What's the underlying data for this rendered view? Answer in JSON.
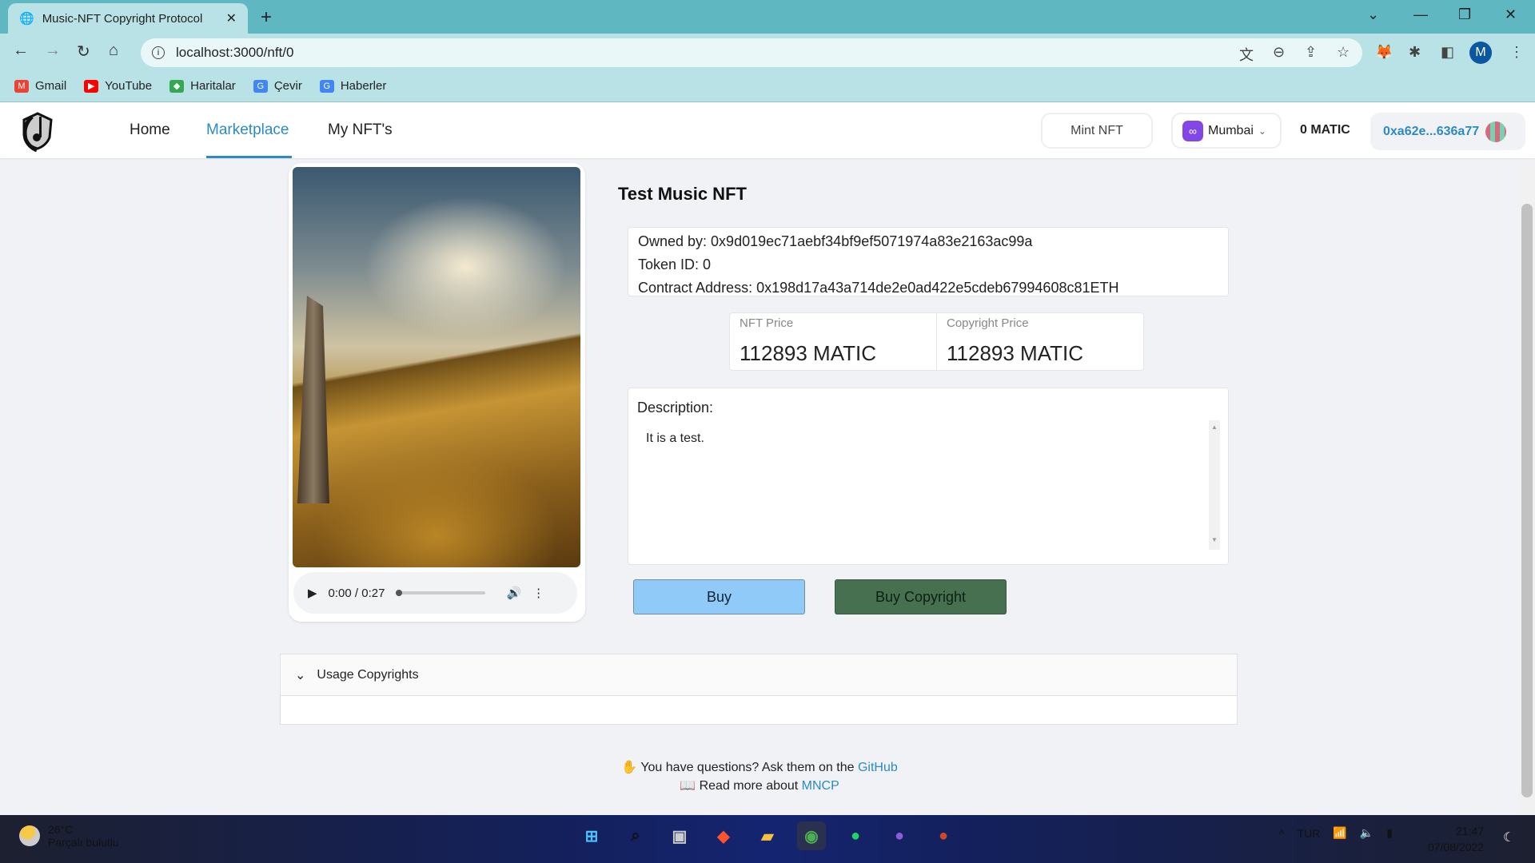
{
  "browser": {
    "tab_title": "Music-NFT Copyright Protocol",
    "url": "localhost:3000/nft/0",
    "bookmarks": [
      {
        "label": "Gmail",
        "color": "#ea4335"
      },
      {
        "label": "YouTube",
        "color": "#ff0000"
      },
      {
        "label": "Haritalar",
        "color": "#34a853"
      },
      {
        "label": "Çevir",
        "color": "#4285f4"
      },
      {
        "label": "Haberler",
        "color": "#4285f4"
      }
    ],
    "profile_initial": "M"
  },
  "app": {
    "nav": {
      "home": "Home",
      "marketplace": "Marketplace",
      "my_nfts": "My NFT's",
      "active": "Marketplace"
    },
    "mint_label": "Mint NFT",
    "network": "Mumbai",
    "balance": "0 MATIC",
    "account": "0xa62e...636a77",
    "accent": "#2b8bc4"
  },
  "nft": {
    "title": "Test Music NFT",
    "owned_by": "Owned by: 0x9d019ec71aebf34bf9ef5071974a83e2163ac99a",
    "token_id": "Token ID: 0",
    "contract": "Contract Address: 0x198d17a43a714de2e0ad422e5cdeb67994608c81ETH",
    "nft_price_label": "NFT Price",
    "nft_price": "112893 MATIC",
    "copyright_price_label": "Copyright Price",
    "copyright_price": "112893 MATIC",
    "description_label": "Description:",
    "description": "It is a test.",
    "audio_time": "0:00 / 0:27",
    "buy_label": "Buy",
    "buy_copyright_label": "Buy Copyright",
    "buy_color": "#90caf9",
    "buy_copyright_color": "#46704f"
  },
  "usage": {
    "label": "Usage Copyrights"
  },
  "footer": {
    "q_text": "You have questions? Ask them on the ",
    "q_link": "GitHub",
    "r_text": "Read more about ",
    "r_link": "MNCP"
  },
  "taskbar": {
    "temp": "26°C",
    "weather": "Parçalı bulutlu",
    "lang": "TUR",
    "time": "21:47",
    "date": "07/08/2022"
  }
}
